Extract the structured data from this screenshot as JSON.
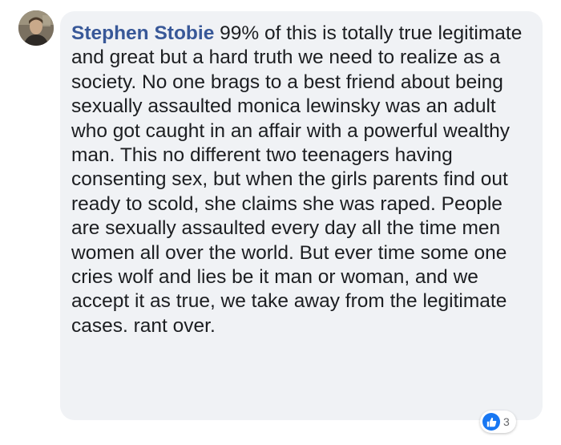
{
  "comment": {
    "author": "Stephen Stobie",
    "text": "99% of this is totally true legitimate and great but a hard truth we need to realize as a society. No one brags to a best friend about being sexually assaulted monica lewinsky was an adult who got caught in an affair with a powerful wealthy man. This no different two teenagers having consenting sex, but when the girls parents find out ready to scold, she claims she was raped. People are sexually assaulted every day all the time men women all over the world. But ever time some one cries wolf and lies be it man or woman, and we accept it as true, we take away from the legitimate cases. rant over.",
    "reactions": {
      "icon": "like-icon",
      "count": "3"
    }
  },
  "colors": {
    "bubble_bg": "#f0f2f5",
    "author_link": "#385898",
    "text": "#1c1e21",
    "like_blue": "#1877f2",
    "count_gray": "#65676b"
  }
}
